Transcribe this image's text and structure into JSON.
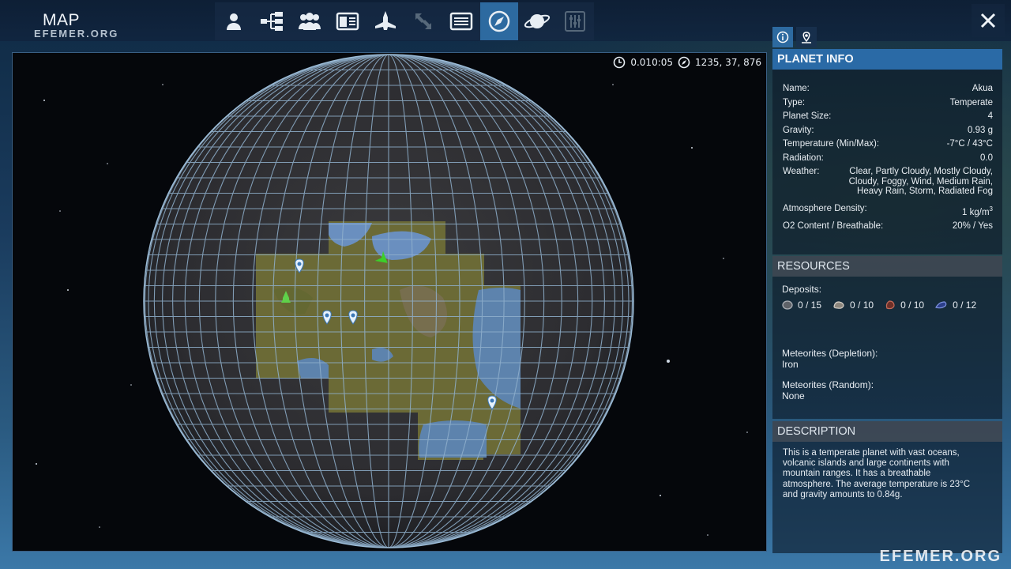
{
  "header": {
    "title": "MAP",
    "subtitle": "EFEMER.ORG"
  },
  "nav": {
    "items": [
      {
        "name": "nav-character",
        "icon": "person-icon"
      },
      {
        "name": "nav-tech-tree",
        "icon": "tree-icon"
      },
      {
        "name": "nav-group",
        "icon": "group-icon"
      },
      {
        "name": "nav-codex",
        "icon": "book-icon"
      },
      {
        "name": "nav-ship",
        "icon": "spaceship-icon"
      },
      {
        "name": "nav-transfer",
        "icon": "transfer-icon",
        "disabled": true
      },
      {
        "name": "nav-log",
        "icon": "list-icon"
      },
      {
        "name": "nav-map",
        "icon": "compass-icon",
        "active": true
      },
      {
        "name": "nav-planet",
        "icon": "planet-icon"
      },
      {
        "name": "nav-settings",
        "icon": "sliders-icon",
        "disabled": true
      }
    ]
  },
  "map": {
    "time": "0.010:05",
    "coords": "1235, 37, 876"
  },
  "planet_info": {
    "header": "PLANET INFO",
    "rows": [
      {
        "label": "Name:",
        "value": "Akua"
      },
      {
        "label": "Type:",
        "value": "Temperate"
      },
      {
        "label": "Planet Size:",
        "value": "4"
      },
      {
        "label": "Gravity:",
        "value": "0.93 g"
      },
      {
        "label": "Temperature (Min/Max):",
        "value": "-7°C / 43°C"
      },
      {
        "label": "Radiation:",
        "value": "0.0"
      }
    ],
    "weather_label": "Weather:",
    "weather_lines": [
      "Clear, Partly Cloudy, Mostly Cloudy,",
      "Cloudy, Foggy, Wind, Medium Rain,",
      "Heavy Rain, Storm, Radiated Fog"
    ],
    "atmosphere_label": "Atmosphere Density:",
    "atmosphere_value": "1 kg/m",
    "atmosphere_exp": "3",
    "o2_label": "O2 Content / Breathable:",
    "o2_value": "20% / Yes"
  },
  "resources": {
    "header": "RESOURCES",
    "deposits_label": "Deposits:",
    "deposits": [
      {
        "icon": "ore-gray-icon",
        "value": "0 / 15",
        "color": "#8a8f94"
      },
      {
        "icon": "ore-stone-icon",
        "value": "0 / 10",
        "color": "#b6b0a6"
      },
      {
        "icon": "ore-red-icon",
        "value": "0 / 10",
        "color": "#b35a4a"
      },
      {
        "icon": "ore-blue-icon",
        "value": "0 / 12",
        "color": "#4a6ad0"
      }
    ],
    "meteor_depletion_label": "Meteorites (Depletion):",
    "meteor_depletion_value": "Iron",
    "meteor_random_label": "Meteorites (Random):",
    "meteor_random_value": "None"
  },
  "description": {
    "header": "DESCRIPTION",
    "lines": [
      "This is a temperate planet with vast oceans,",
      "volcanic islands and large continents with",
      "mountain ranges. It has a breathable",
      "atmosphere. The average temperature is 23°C",
      "and gravity amounts to 0.84g."
    ]
  },
  "watermark": "EFEMER.ORG",
  "colors": {
    "accent": "#2d6aa0",
    "grid": "#8fb0cc",
    "land": "#6b6a36",
    "water": "#5d83ad"
  }
}
